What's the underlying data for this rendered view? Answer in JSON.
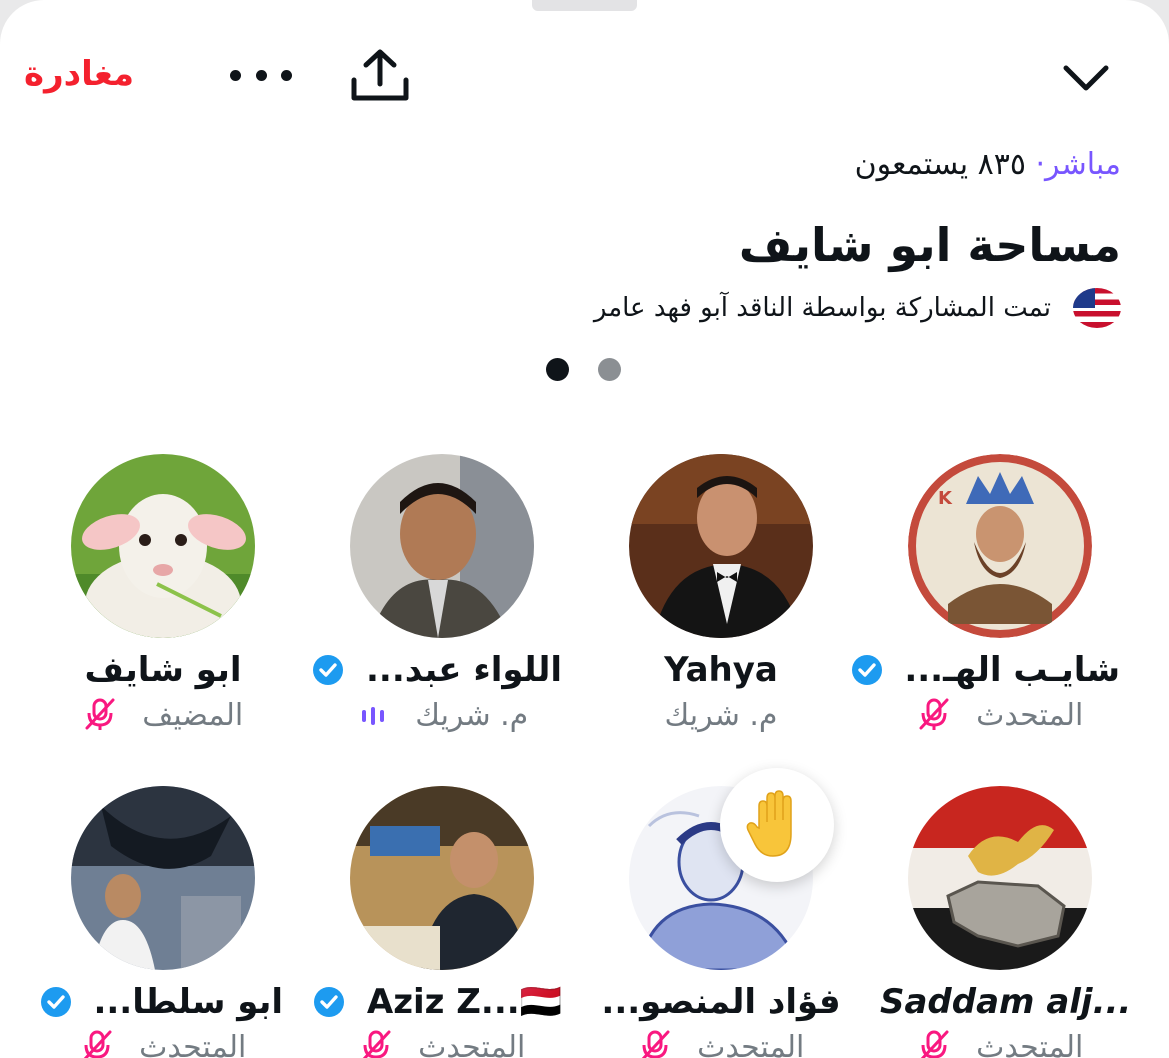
{
  "header": {
    "leave_label": "مغادرة",
    "more_icon": "more-horizontal-icon",
    "share_icon": "share-icon",
    "collapse_icon": "chevron-down-icon"
  },
  "space": {
    "live_label": "مباشر",
    "separator": "·",
    "listeners": "٨٣٥ يستمعون",
    "title": "مساحة ابو شايف",
    "shared_by": "تمت المشاركة بواسطة الناقد آبو فهد عامر",
    "flag_icon": "us-flag-icon"
  },
  "pager": {
    "pages": 2,
    "active_index": 0
  },
  "colors": {
    "accent_red": "#f4212e",
    "live_purple": "#7856ff",
    "mic_pink": "#f91880",
    "verified_blue": "#1d9bf0"
  },
  "participants": [
    {
      "name": "ابو شايف",
      "role": "المضيف",
      "verified": false,
      "status_icon": "mic-off-icon"
    },
    {
      "name": "اللواء عبد...",
      "role": "م. شريك",
      "verified": true,
      "status_icon": "speaking-bars-icon"
    },
    {
      "name": "Yahya",
      "role": "م. شريك",
      "verified": false,
      "status_icon": ""
    },
    {
      "name": "شايـب الهـ...",
      "role": "المتحدث",
      "verified": true,
      "status_icon": "mic-off-icon"
    },
    {
      "name": "ابو سلطا...",
      "role": "المتحدث",
      "verified": true,
      "status_icon": "mic-off-icon"
    },
    {
      "name": "Aziz Z...🇾🇪",
      "role": "المتحدث",
      "verified": true,
      "status_icon": "mic-off-icon"
    },
    {
      "name": "فؤاد المنصو...",
      "role": "المتحدث",
      "verified": false,
      "status_icon": "mic-off-icon",
      "raised_hand": true
    },
    {
      "name": "Saddam alj...",
      "role": "المتحدث",
      "verified": false,
      "status_icon": "mic-off-icon"
    }
  ]
}
